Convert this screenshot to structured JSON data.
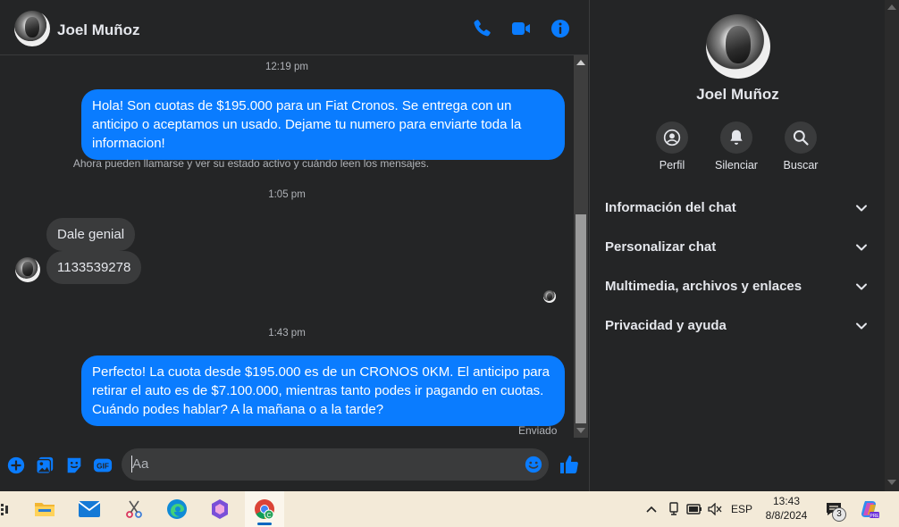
{
  "header": {
    "contact_name": "Joel Muñoz",
    "icons": [
      "phone-icon",
      "video-camera-icon",
      "info-icon"
    ]
  },
  "messages": {
    "time_1": "12:19 pm",
    "msg_out_1": "Hola! Son cuotas de $195.000 para un Fiat Cronos. Se entrega con un anticipo o aceptamos un usado. Dejame tu numero para enviarte toda la informacion!",
    "notice": "Ahora pueden llamarse y ver su estado activo y cuándo leen los mensajes.",
    "time_2": "1:05 pm",
    "msg_in_1": "Dale genial",
    "msg_in_2": "1133539278",
    "time_3": "1:43 pm",
    "msg_out_2": "Perfecto! La cuota desde $195.000 es de un CRONOS 0KM. El anticipo para retirar el auto es de $7.100.000, mientras tanto podes ir pagando en cuotas. Cuándo podes hablar? A la mañana o a la tarde?",
    "status": "Enviado"
  },
  "composer": {
    "placeholder": "Aa",
    "icons": [
      "plus-icon",
      "image-icon",
      "sticker-icon",
      "gif-icon",
      "emoji-icon",
      "like-icon"
    ]
  },
  "panel": {
    "contact_name": "Joel Muñoz",
    "actions": [
      {
        "label": "Perfil",
        "icon": "profile-icon"
      },
      {
        "label": "Silenciar",
        "icon": "bell-icon"
      },
      {
        "label": "Buscar",
        "icon": "search-icon"
      }
    ],
    "sections": [
      {
        "label": "Información del chat"
      },
      {
        "label": "Personalizar chat"
      },
      {
        "label": "Multimedia, archivos y enlaces"
      },
      {
        "label": "Privacidad y ayuda"
      }
    ]
  },
  "taskbar": {
    "time": "13:43",
    "date": "8/8/2024",
    "language": "ESP",
    "notification_count": "3"
  },
  "colors": {
    "accent": "#0a7cff",
    "background": "#242526",
    "incoming_bubble": "#3a3b3c",
    "taskbar": "#f3ead8"
  }
}
